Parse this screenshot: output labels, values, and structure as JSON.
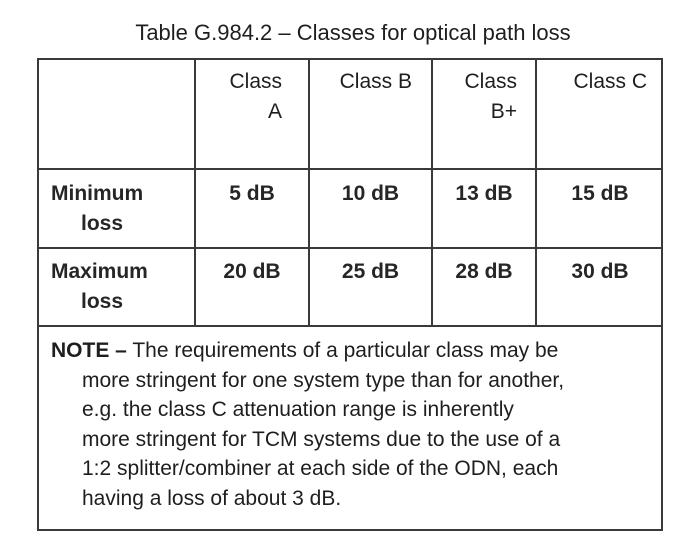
{
  "title": "Table G.984.2 – Classes for optical path loss",
  "table": {
    "columns": [
      {
        "line1": "Class",
        "line2": "A"
      },
      {
        "line1": "Class B",
        "line2": ""
      },
      {
        "line1": "Class",
        "line2": "B+"
      },
      {
        "line1": "Class C",
        "line2": ""
      }
    ],
    "rows": [
      {
        "label_line1": "Minimum",
        "label_line2": "loss",
        "values": [
          "5 dB",
          "10 dB",
          "13 dB",
          "15 dB"
        ]
      },
      {
        "label_line1": "Maximum",
        "label_line2": "loss",
        "values": [
          "20 dB",
          "25 dB",
          "28 dB",
          "30 dB"
        ]
      }
    ],
    "note": {
      "prefix": "NOTE –",
      "lines": [
        " The requirements of a particular class may be",
        "more stringent for one system type than for another,",
        "e.g. the class C attenuation range is inherently",
        "more stringent for TCM systems due to the use of a",
        "1:2 splitter/combiner at each side of the ODN, each",
        "having a loss of about 3 dB."
      ]
    }
  }
}
